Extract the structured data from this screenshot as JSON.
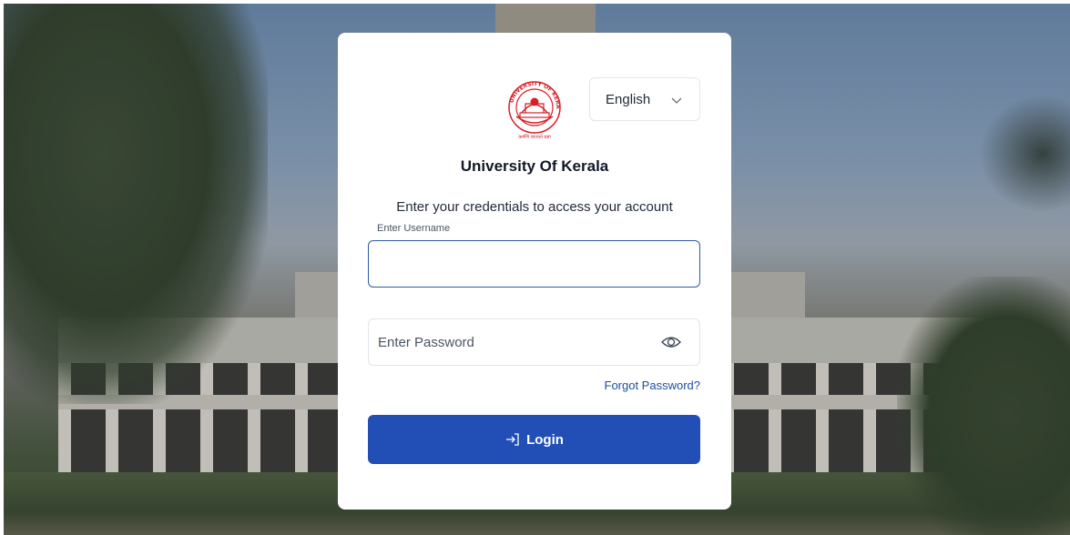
{
  "background": {
    "scene": "campus-building-photo"
  },
  "language": {
    "selected": "English",
    "icon": "chevron-down-icon"
  },
  "logo": {
    "name": "university-seal",
    "text_top": "UNIVERSITY OF KERALA",
    "text_bottom": "कर्मणि व्यज्यते प्रज्ञा"
  },
  "title": "University Of Kerala",
  "subtitle": "Enter your credentials to access your account",
  "username": {
    "label": "Enter Username",
    "value": ""
  },
  "password": {
    "placeholder": "Enter Password",
    "value": "",
    "icon": "eye-icon"
  },
  "forgot_label": "Forgot Password?",
  "login": {
    "label": "Login",
    "icon": "login-arrow-icon"
  },
  "colors": {
    "primary": "#224fb5",
    "link": "#1d4ea6",
    "seal": "#d72027"
  }
}
